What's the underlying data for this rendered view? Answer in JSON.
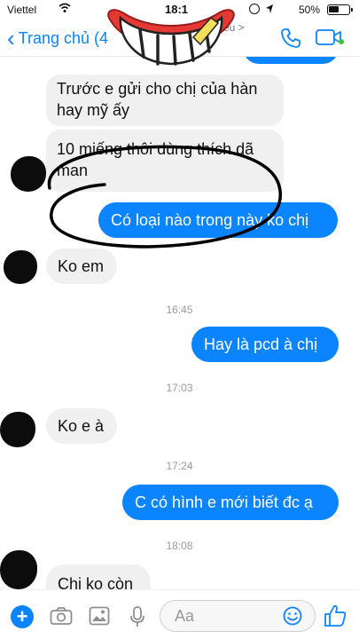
{
  "status_bar": {
    "carrier": "Viettel",
    "time": "18:1",
    "battery": "50%"
  },
  "header": {
    "back_label": "Trang chủ (4",
    "contact_fragment": "ều >",
    "accent_color": "#0a84ff",
    "icons": [
      "back-chevron-icon",
      "phone-icon",
      "video-camera-icon"
    ]
  },
  "messages": [
    {
      "direction": "in",
      "text": "Trước e gửi cho chị của hàn hay mỹ ấy"
    },
    {
      "direction": "in",
      "text": "10 miếng thôi dùng thích dã man"
    },
    {
      "direction": "out",
      "text": "Có loại nào trong này ko chị"
    },
    {
      "direction": "in",
      "text": "Ko em"
    },
    {
      "direction": "time",
      "text": "16:45"
    },
    {
      "direction": "out",
      "text": "Hay là pcd à chị"
    },
    {
      "direction": "time",
      "text": "17:03"
    },
    {
      "direction": "in",
      "text": "Ko e à"
    },
    {
      "direction": "time",
      "text": "17:24"
    },
    {
      "direction": "out",
      "text": "C có hình e mới biết đc ạ"
    },
    {
      "direction": "time",
      "text": "18:08"
    },
    {
      "direction": "in",
      "text": "Chi ko còn"
    }
  ],
  "composer": {
    "placeholder": "Aa",
    "icons": [
      "plus-icon",
      "camera-icon",
      "image-icon",
      "microphone-icon",
      "emoji-icon",
      "thumbs-up-icon"
    ]
  }
}
